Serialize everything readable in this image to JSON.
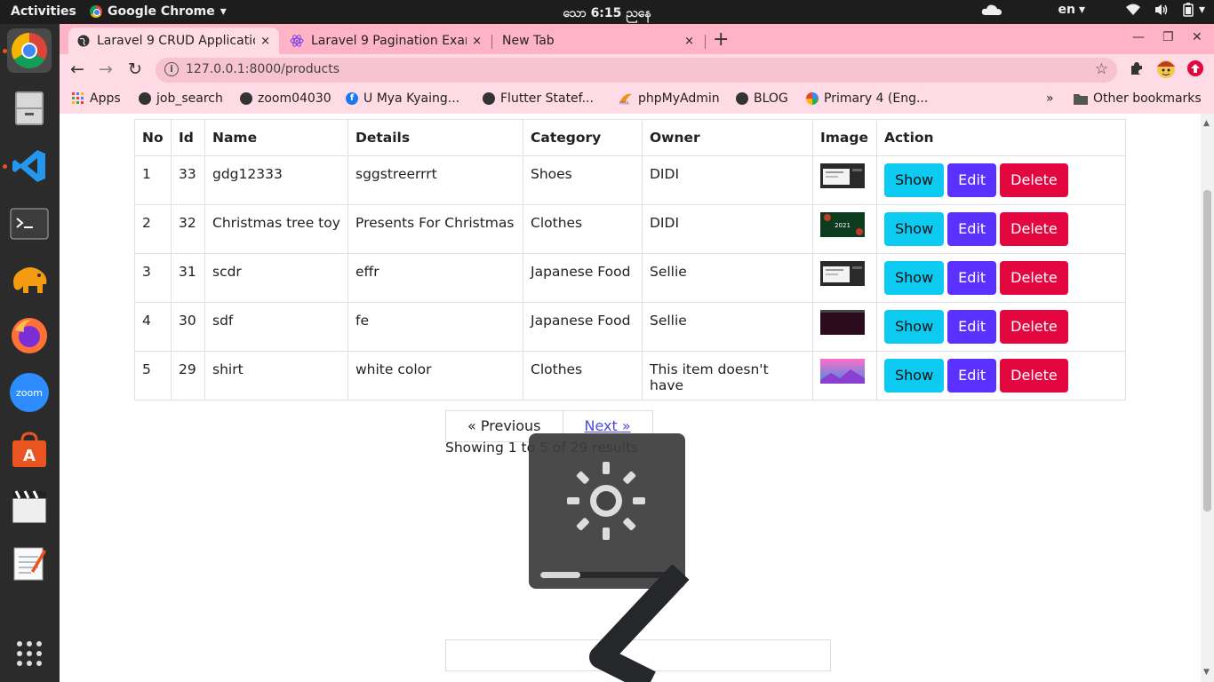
{
  "topbar": {
    "activities": "Activities",
    "app_name": "Google Chrome",
    "app_arrow": "▾",
    "clock": "သော   6:15 ညနေ",
    "lang": "en",
    "lang_arrow": "▾",
    "power_arrow": "▾"
  },
  "tabs": [
    {
      "title": "Laravel 9 CRUD Applicatio",
      "close": "×"
    },
    {
      "title": "Laravel 9 Pagination Exam",
      "close": "×"
    },
    {
      "title": "New Tab",
      "close": "×"
    }
  ],
  "new_tab": "+",
  "window_controls": {
    "minimize": "—",
    "maximize": "❐",
    "close": "✕"
  },
  "nav": {
    "back": "←",
    "forward": "→",
    "reload": "↻"
  },
  "omnibox": {
    "info": "i",
    "url": "127.0.0.1:8000/products",
    "star": "☆"
  },
  "bookmarks": [
    {
      "label": "Apps",
      "icon": "apps-grid-icon",
      "color": "#e94235"
    },
    {
      "label": "job_search",
      "icon": "globe-icon",
      "color": "#333333"
    },
    {
      "label": "zoom04030",
      "icon": "globe-icon",
      "color": "#333333"
    },
    {
      "label": "U Mya Kyaing...",
      "icon": "facebook-icon",
      "color": "#1877f2"
    },
    {
      "label": "Flutter Statef...",
      "icon": "globe-icon",
      "color": "#333333"
    },
    {
      "label": "phpMyAdmin",
      "icon": "pma-icon",
      "color": "#f29111"
    },
    {
      "label": "BLOG",
      "icon": "globe-icon",
      "color": "#333333"
    },
    {
      "label": "Primary 4 (Eng...",
      "icon": "google-icon",
      "color": "#4285f4"
    }
  ],
  "bookmarks_more": "»",
  "other_bookmarks": "Other bookmarks",
  "table": {
    "headers": [
      "No",
      "Id",
      "Name",
      "Details",
      "Category",
      "Owner",
      "Image",
      "Action"
    ],
    "rows": [
      {
        "no": "1",
        "id": "33",
        "name": "gdg12333",
        "details": "sggstreerrrt",
        "category": "Shoes",
        "owner": "DIDI",
        "image": "screenshot"
      },
      {
        "no": "2",
        "id": "32",
        "name": "Christmas tree toy",
        "details": "Presents For Christmas",
        "category": "Clothes",
        "owner": "DIDI",
        "image": "2021"
      },
      {
        "no": "3",
        "id": "31",
        "name": "scdr",
        "details": "effr",
        "category": "Japanese Food",
        "owner": "Sellie",
        "image": "screenshot"
      },
      {
        "no": "4",
        "id": "30",
        "name": "sdf",
        "details": "fe",
        "category": "Japanese Food",
        "owner": "Sellie",
        "image": "dark"
      },
      {
        "no": "5",
        "id": "29",
        "name": "shirt",
        "details": "white color",
        "category": "Clothes",
        "owner": "This item doesn't have",
        "image": "pink"
      }
    ],
    "actions": {
      "show": "Show",
      "edit": "Edit",
      "delete": "Delete"
    }
  },
  "pagination": {
    "previous": "« Previous",
    "next": "Next »",
    "summary": "Showing 1 to 5 of 29 results"
  },
  "osd": {
    "icon": "brightness-icon",
    "level": 0.3
  },
  "colors": {
    "tabstrip": "#ffb3c7",
    "toolbar": "#ffdbe5",
    "show": "#0dcaf0",
    "edit": "#5b31ff",
    "delete": "#e3063f"
  }
}
